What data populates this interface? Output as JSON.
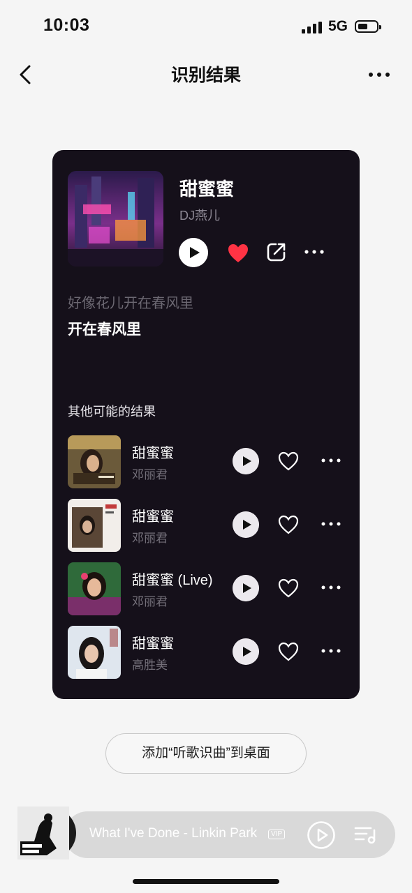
{
  "status_bar": {
    "time": "10:03",
    "network": "5G"
  },
  "header": {
    "title": "识别结果"
  },
  "result": {
    "title": "甜蜜蜜",
    "artist": "DJ燕儿",
    "lyric_line_1": "好像花儿开在春风里",
    "lyric_line_2": "开在春风里"
  },
  "others": {
    "title": "其他可能的结果",
    "items": [
      {
        "title": "甜蜜蜜",
        "artist": "邓丽君"
      },
      {
        "title": "甜蜜蜜",
        "artist": "邓丽君"
      },
      {
        "title": "甜蜜蜜 (Live)",
        "artist": "邓丽君"
      },
      {
        "title": "甜蜜蜜",
        "artist": "高胜美"
      }
    ]
  },
  "add_desktop_label": "添加“听歌识曲”到桌面",
  "mini_player": {
    "text": "What I've Done - Linkin Park",
    "badge": "VIP"
  },
  "colors": {
    "card_bg": "#15101a",
    "heart_red": "#ff3344",
    "page_bg": "#f5f5f5"
  },
  "icons": [
    "back-icon",
    "more-icon",
    "play-icon",
    "heart-filled-icon",
    "share-icon",
    "heart-outline-icon",
    "playlist-icon"
  ]
}
